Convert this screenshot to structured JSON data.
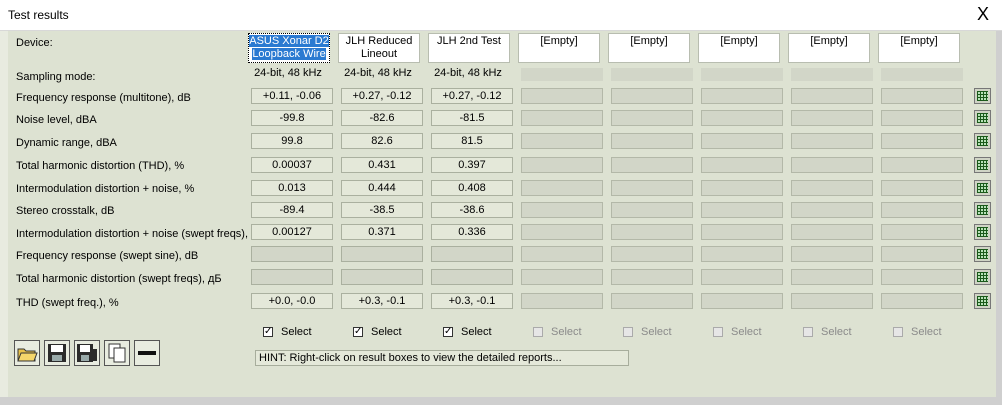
{
  "window": {
    "title": "Test results",
    "close_glyph": "X"
  },
  "labels": {
    "device": "Device:",
    "sampling": "Sampling mode:",
    "rows": [
      "Frequency response (multitone), dB",
      "Noise level, dBA",
      "Dynamic range, dBA",
      "Total harmonic distortion (THD), %",
      "Intermodulation distortion + noise, %",
      "Stereo crosstalk, dB",
      "Intermodulation distortion + noise (swept freqs), %",
      "Frequency response (swept sine), dB",
      "Total harmonic distortion (swept freqs), дБ",
      "THD (swept freq.), %"
    ]
  },
  "devices": [
    {
      "line1": "ASUS Xonar D2",
      "line2": "Loopback Wire",
      "selected": true
    },
    {
      "line1": "JLH Reduced",
      "line2": "Lineout"
    },
    {
      "line1": "JLH 2nd Test",
      "line2": ""
    },
    {
      "line1": "[Empty]",
      "line2": ""
    },
    {
      "line1": "[Empty]",
      "line2": ""
    },
    {
      "line1": "[Empty]",
      "line2": ""
    },
    {
      "line1": "[Empty]",
      "line2": ""
    },
    {
      "line1": "[Empty]",
      "line2": ""
    }
  ],
  "sampling": [
    "24-bit, 48 kHz",
    "24-bit, 48 kHz",
    "24-bit, 48 kHz",
    "",
    "",
    "",
    "",
    ""
  ],
  "results": [
    [
      "+0.11, -0.06",
      "+0.27, -0.12",
      "+0.27, -0.12"
    ],
    [
      "-99.8",
      "-82.6",
      "-81.5"
    ],
    [
      "99.8",
      "82.6",
      "81.5"
    ],
    [
      "0.00037",
      "0.431",
      "0.397"
    ],
    [
      "0.013",
      "0.444",
      "0.408"
    ],
    [
      "-89.4",
      "-38.5",
      "-38.6"
    ],
    [
      "0.00127",
      "0.371",
      "0.336"
    ],
    [
      "",
      "",
      ""
    ],
    [
      "",
      "",
      ""
    ],
    [
      "+0.0, -0.0",
      "+0.3, -0.1",
      "+0.3, -0.1"
    ]
  ],
  "select": {
    "label": "Select",
    "checked": [
      true,
      true,
      true,
      false,
      false,
      false,
      false,
      false
    ]
  },
  "hint": "HINT: Right-click on result boxes to view the detailed reports...",
  "toolbar_icons": [
    "open-folder-icon",
    "save-icon",
    "save-as-icon",
    "copy-icon",
    "minus-icon"
  ]
}
